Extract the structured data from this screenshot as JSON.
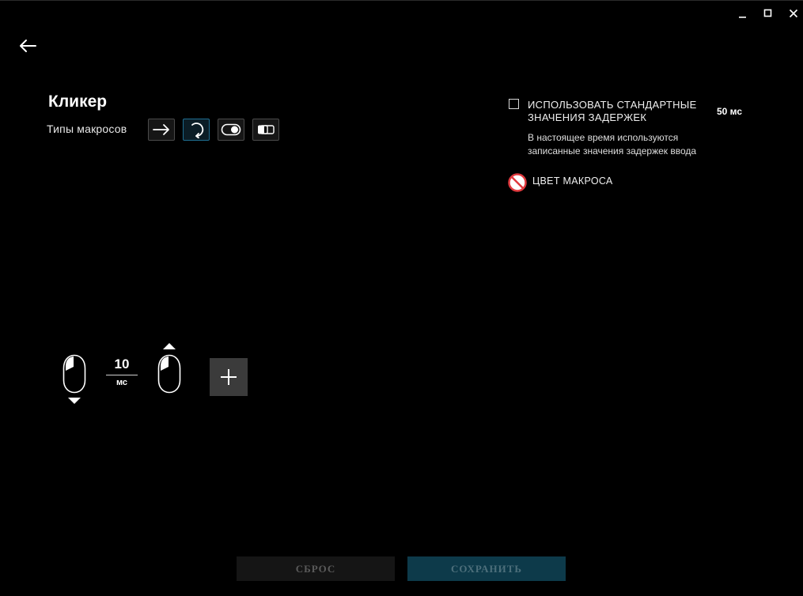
{
  "window": {
    "controls": [
      "minimize-icon",
      "maximize-icon",
      "close-icon"
    ]
  },
  "header": {
    "back_icon": "arrow-left-icon"
  },
  "macro": {
    "title": "Кликер",
    "types_label": "Типы макросов",
    "type_icons": [
      "arrow-right-icon",
      "repeat-icon",
      "toggle-icon",
      "sequence-icon"
    ],
    "active_type_index": 1
  },
  "settings": {
    "use_default_delays": {
      "label": "ИСПОЛЬЗОВАТЬ СТАНДАРТНЫЕ ЗНАЧЕНИЯ ЗАДЕРЖЕК",
      "checked": false,
      "value": "50 мс"
    },
    "delay_note": "В настоящее время используются записанные значения задержек ввода",
    "macro_color": {
      "label": "ЦВЕТ МАКРОСА",
      "icon": "no-color-icon"
    }
  },
  "sequence": {
    "steps": [
      {
        "type": "mouse-left-down",
        "icon": "mouse-left-icon",
        "arrow": "down"
      },
      {
        "type": "delay",
        "value": "10",
        "unit": "мс"
      },
      {
        "type": "mouse-left-up",
        "icon": "mouse-left-icon",
        "arrow": "up"
      }
    ],
    "add_icon": "plus-icon"
  },
  "footer": {
    "reset_label": "СБРОС",
    "save_label": "СОХРАНИТЬ"
  },
  "colors": {
    "background": "#000000",
    "accent": "#1f6e91",
    "save_bg": "#0d3a4a",
    "reset_bg": "#151515",
    "color_none": "#e0393e"
  }
}
